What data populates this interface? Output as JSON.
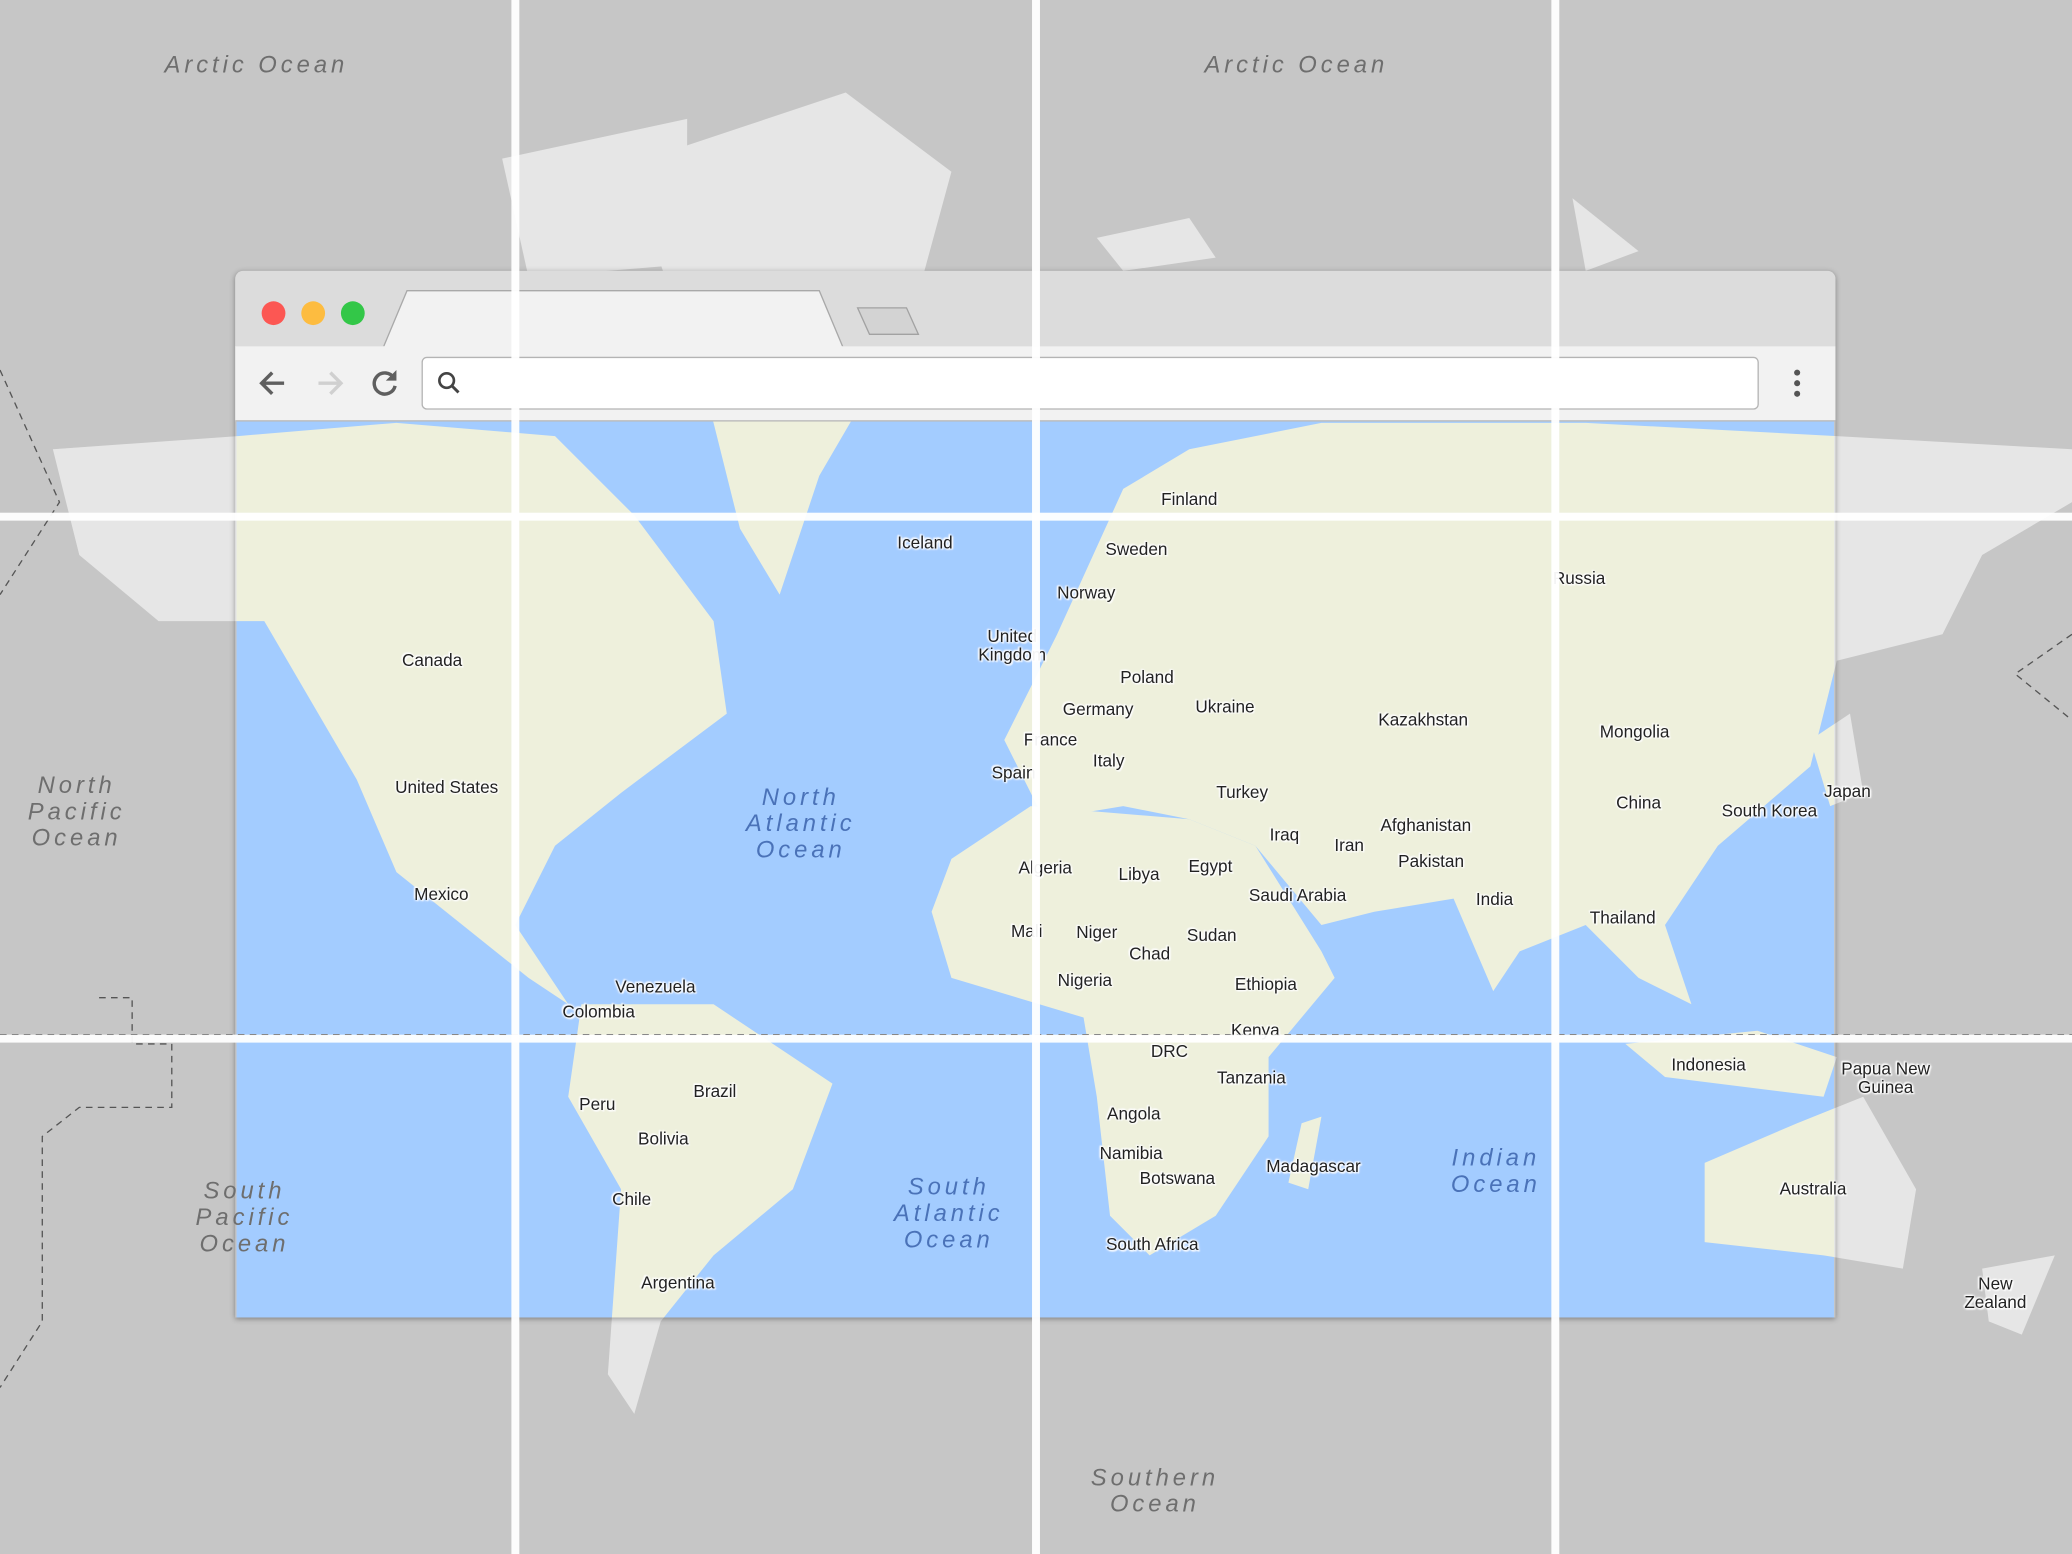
{
  "browser": {
    "traffic_lights": {
      "close": "#fc5753",
      "minimize": "#fdbc40",
      "maximize": "#33c748"
    },
    "tab_title": "",
    "address_bar": {
      "value": "",
      "placeholder": ""
    },
    "icons": [
      "back-arrow-icon",
      "forward-arrow-icon",
      "reload-icon",
      "search-icon",
      "more-vertical-icon"
    ]
  },
  "colors": {
    "water": "#a3ccff",
    "land": "#eef0dc",
    "outside_background": "#c6c6c6",
    "outside_land": "#e6e6e6"
  },
  "map": {
    "countries": [
      "Finland",
      "Iceland",
      "Sweden",
      "Norway",
      "Russia",
      "United\nKingdom",
      "Poland",
      "Canada",
      "Germany",
      "Ukraine",
      "Kazakhstan",
      "Mongolia",
      "France",
      "Italy",
      "Spain",
      "United States",
      "Turkey",
      "Japan",
      "China",
      "South Korea",
      "Iraq",
      "Iran",
      "Afghanistan",
      "Algeria",
      "Libya",
      "Egypt",
      "Pakistan",
      "Saudi Arabia",
      "Mexico",
      "India",
      "Thailand",
      "Mali",
      "Niger",
      "Sudan",
      "Chad",
      "Ethiopia",
      "Venezuela",
      "Nigeria",
      "Colombia",
      "Kenya",
      "DRC",
      "Indonesia",
      "Papua New\nGuinea",
      "Tanzania",
      "Brazil",
      "Peru",
      "Angola",
      "Bolivia",
      "Namibia",
      "Madagascar",
      "Botswana",
      "Australia",
      "Chile",
      "South Africa",
      "Argentina",
      "New\nZealand"
    ],
    "oceans": [
      "Arctic Ocean",
      "Arctic Ocean",
      "North\nPacific\nOcean",
      "North\nAtlantic\nOcean",
      "South\nAtlantic\nOcean",
      "Indian\nOcean",
      "South\nPacific\nOcean",
      "Southern\nOcean"
    ]
  }
}
